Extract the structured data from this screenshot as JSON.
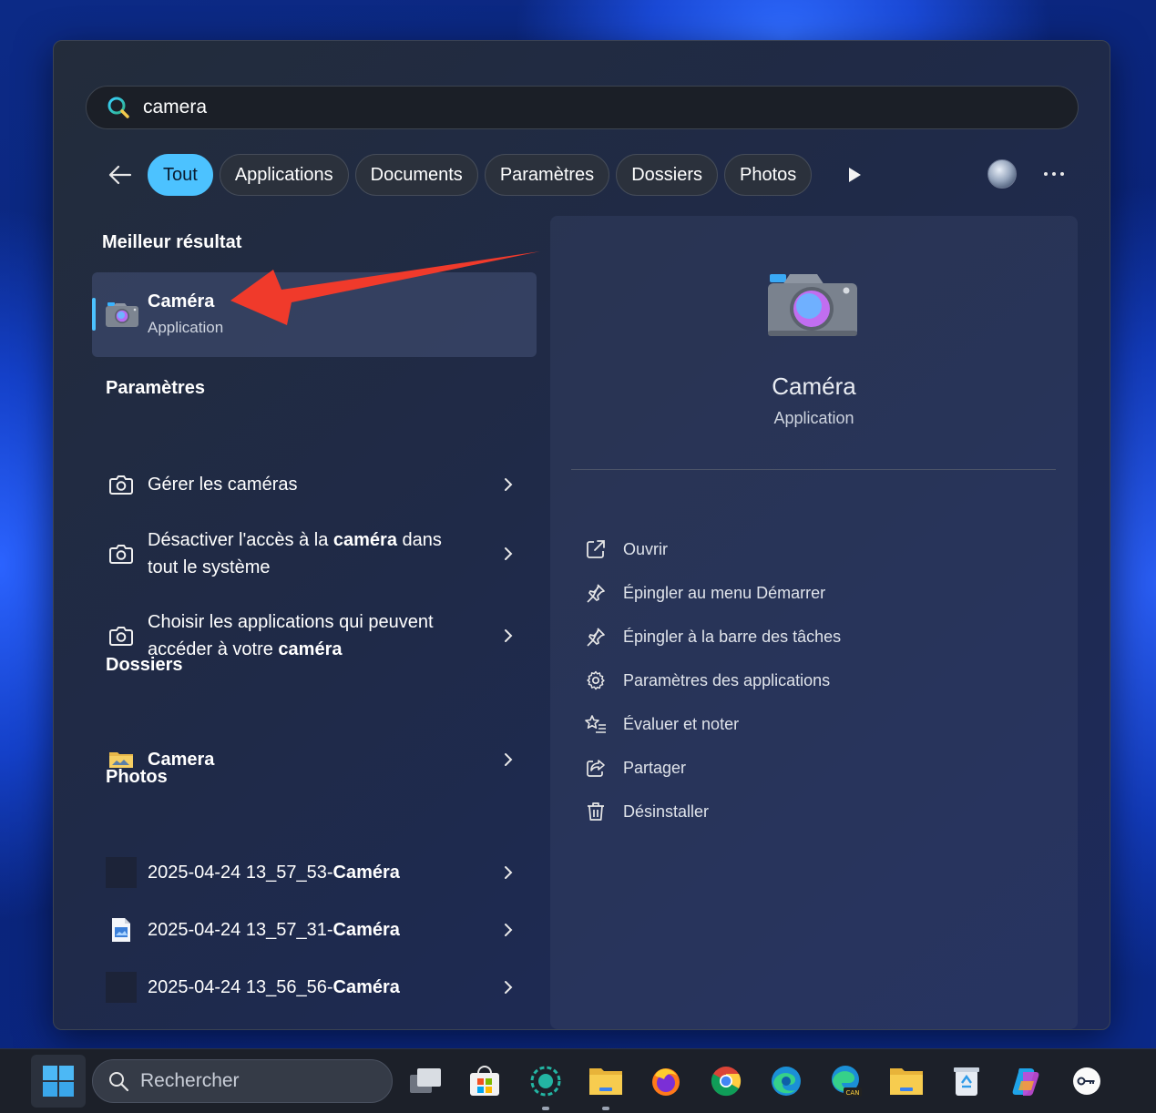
{
  "search": {
    "value": "camera"
  },
  "filters": [
    {
      "label": "Tout",
      "active": true
    },
    {
      "label": "Applications"
    },
    {
      "label": "Documents"
    },
    {
      "label": "Paramètres"
    },
    {
      "label": "Dossiers"
    },
    {
      "label": "Photos"
    }
  ],
  "best": {
    "section": "Meilleur résultat",
    "name": "Caméra",
    "type": "Application"
  },
  "settings": {
    "section": "Paramètres",
    "items": [
      {
        "pre": "Gérer les caméras",
        "bold": "",
        "post": ""
      },
      {
        "pre": "Désactiver l'accès à la ",
        "bold": "caméra",
        "post": " dans tout le système"
      },
      {
        "pre": "Choisir les applications qui peuvent accéder à votre ",
        "bold": "caméra",
        "post": ""
      }
    ]
  },
  "folders": {
    "section": "Dossiers",
    "items": [
      {
        "label": "Camera"
      }
    ]
  },
  "photos": {
    "section": "Photos",
    "items": [
      {
        "pre": "2025-04-24 13_57_53-",
        "bold": "Caméra"
      },
      {
        "pre": "2025-04-24 13_57_31-",
        "bold": "Caméra"
      },
      {
        "pre": "2025-04-24 13_56_56-",
        "bold": "Caméra"
      }
    ]
  },
  "preview": {
    "name": "Caméra",
    "type": "Application",
    "actions": [
      {
        "label": "Ouvrir",
        "icon": "open-external-icon"
      },
      {
        "label": "Épingler au menu Démarrer",
        "icon": "pin-icon"
      },
      {
        "label": "Épingler à la barre des tâches",
        "icon": "pin-icon"
      },
      {
        "label": "Paramètres des applications",
        "icon": "gear-icon"
      },
      {
        "label": "Évaluer et noter",
        "icon": "star-list-icon"
      },
      {
        "label": "Partager",
        "icon": "share-icon"
      },
      {
        "label": "Désinstaller",
        "icon": "trash-icon"
      }
    ]
  },
  "taskbar": {
    "search_placeholder": "Rechercher",
    "apps": [
      "task-view",
      "microsoft-store",
      "app-circle",
      "file-explorer",
      "firefox",
      "chrome",
      "edge",
      "edge-can",
      "folder",
      "recycle-bin",
      "copilot",
      "key-app"
    ]
  },
  "colors": {
    "accent": "#4cc2ff",
    "annotation_arrow": "#f03a2b"
  }
}
